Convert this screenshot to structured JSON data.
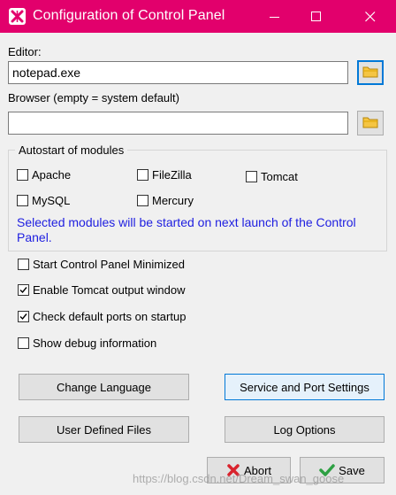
{
  "window": {
    "title": "Configuration of Control Panel"
  },
  "editor": {
    "label": "Editor:",
    "value": "notepad.exe"
  },
  "browser": {
    "label": "Browser (empty = system default)",
    "value": ""
  },
  "autostart": {
    "title": "Autostart of modules",
    "modules": [
      {
        "label": "Apache",
        "checked": false
      },
      {
        "label": "FileZilla",
        "checked": false
      },
      {
        "label": "Tomcat",
        "checked": false
      },
      {
        "label": "MySQL",
        "checked": false
      },
      {
        "label": "Mercury",
        "checked": false
      }
    ],
    "note": "Selected modules will be started on next launch of the Control Panel."
  },
  "options": [
    {
      "label": "Start Control Panel Minimized",
      "checked": false
    },
    {
      "label": "Enable Tomcat output window",
      "checked": true
    },
    {
      "label": "Check default ports on startup",
      "checked": true
    },
    {
      "label": "Show debug information",
      "checked": false
    }
  ],
  "buttons": {
    "change_language": "Change Language",
    "service_port_settings": "Service and Port Settings",
    "user_defined_files": "User Defined Files",
    "log_options": "Log Options",
    "abort": "Abort",
    "save": "Save"
  },
  "watermark": "https://blog.csdn.net/Dream_swan_goose",
  "colors": {
    "titlebar": "#e2006c",
    "note_text": "#1e1ee0",
    "accent": "#0078d7"
  }
}
